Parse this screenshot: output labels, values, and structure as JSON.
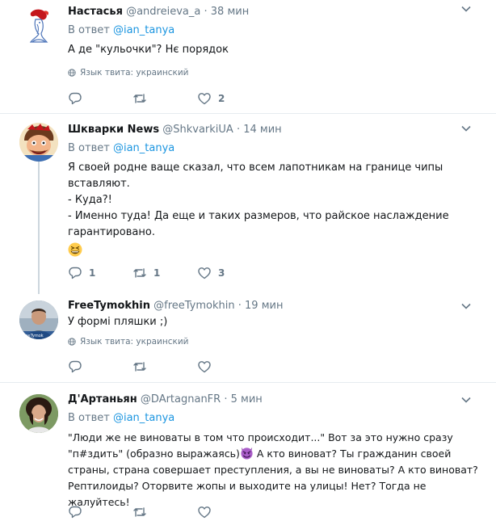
{
  "tweets": [
    {
      "name": "Настасья",
      "handle": "@andreieva_a",
      "dot": "·",
      "time": "38 мин",
      "reply_prefix": "В ответ ",
      "reply_mention": "@ian_tanya",
      "text": "А де \"кульочки\"? Нє порядок",
      "lang": "Язык твита: украинский",
      "replies": "",
      "retweets": "",
      "likes": "2"
    },
    {
      "name": "Шкварки News",
      "handle": "@ShkvarkiUA",
      "dot": "·",
      "time": "14 мин",
      "reply_prefix": "В ответ ",
      "reply_mention": "@ian_tanya",
      "text_lines": [
        "Я своей родне ваще сказал, что всем лапотникам на границе чипы",
        "вставляют.",
        "- Куда?!",
        "- Именно туда! Да еще и таких размеров, что райское наслаждение",
        "гарантировано."
      ],
      "emoji": "grinning-squinting-face",
      "replies": "1",
      "retweets": "1",
      "likes": "3"
    },
    {
      "name": "FreeTymokhin",
      "handle": "@freeTymokhin",
      "dot": "·",
      "time": "19 мин",
      "text": "У формі пляшки ;)",
      "lang": "Язык твита: украинский",
      "avatar_caption": "FreeTymok",
      "replies": "",
      "retweets": "",
      "likes": ""
    },
    {
      "name": "Д'Артаньян",
      "handle": "@DArtagnanFR",
      "dot": "·",
      "time": "5 мин",
      "reply_prefix": "В ответ ",
      "reply_mention": "@ian_tanya",
      "text_lines": [
        "\"Люди же не виноваты в том что происходит...\" Вот за это нужно сразу",
        "\"п#здить\" (образно выражаясь)",
        " А кто виноват? Ты гражданин своей",
        "страны, страна совершает преступления, а вы не виноваты? А кто виноват?",
        "Рептилоиды? Оторвите жопы и выходите на улицы! Нет? Тогда не жалуйтесь!"
      ],
      "emoji": "smiling-imp",
      "replies": "",
      "retweets": "",
      "likes": ""
    }
  ],
  "colors": {
    "text": "#14171a",
    "muted": "#657786",
    "link": "#1b95e0",
    "border": "#e6ecf0",
    "thread": "#ccd6dd"
  },
  "icons": [
    "reply-icon",
    "retweet-icon",
    "like-icon",
    "globe-icon",
    "chevron-down-icon"
  ]
}
